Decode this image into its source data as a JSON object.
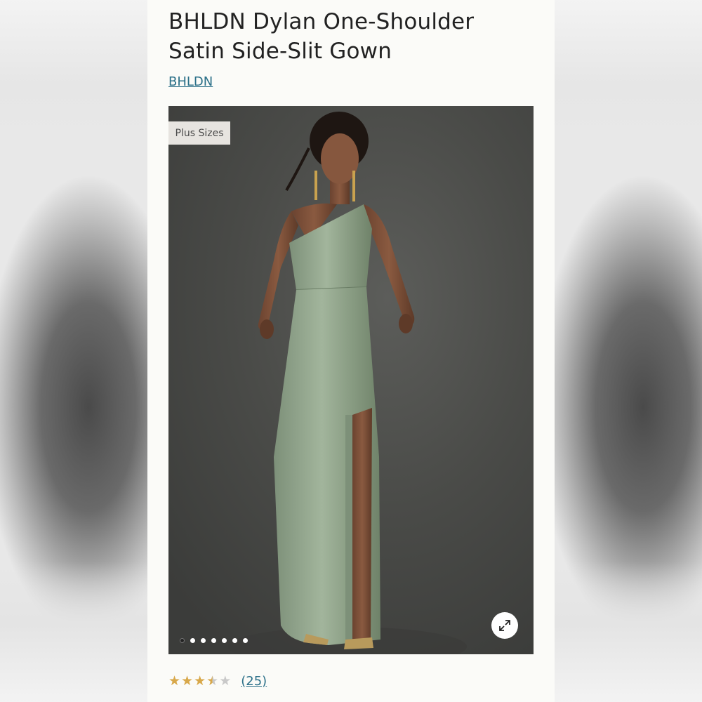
{
  "product": {
    "title": "BHLDN Dylan One-Shoulder Satin Side-Slit Gown",
    "brand": "BHLDN"
  },
  "gallery": {
    "badge": "Plus Sizes",
    "dots": [
      {
        "active": false
      },
      {
        "active": true
      },
      {
        "active": true
      },
      {
        "active": true
      },
      {
        "active": true
      },
      {
        "active": true
      },
      {
        "active": true
      }
    ],
    "expand_icon": "expand-arrows-icon"
  },
  "rating": {
    "stars": 3.5,
    "max": 5,
    "count": "(25)"
  },
  "colors": {
    "link": "#2a6f88",
    "star": "#d8a84a",
    "gown": "#8fa38a",
    "backdrop": "#4a4b48"
  }
}
